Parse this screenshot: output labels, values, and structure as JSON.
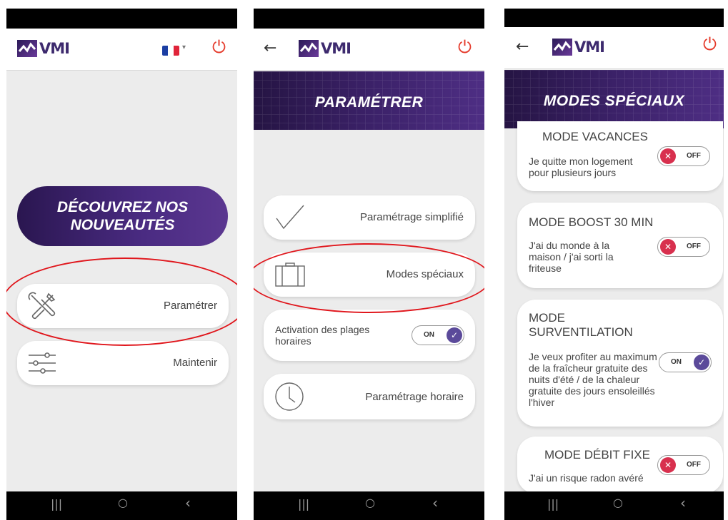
{
  "brand": {
    "logo_text": "VMI",
    "accent": "#4a2b82",
    "power_color": "#e53b2c"
  },
  "screen1": {
    "hero_line1": "DÉCOUVREZ NOS",
    "hero_line2": "NOUVEAUTÉS",
    "menu": [
      {
        "label": "Paramétrer",
        "icon": "tools-icon"
      },
      {
        "label": "Maintenir",
        "icon": "sliders-icon"
      }
    ]
  },
  "screen2": {
    "title": "PARAMÉTRER",
    "items": [
      {
        "label": "Paramétrage simplifié",
        "icon": "checkmark-icon"
      },
      {
        "label": "Modes spéciaux",
        "icon": "suitcase-icon"
      },
      {
        "label": "Activation des plages horaires",
        "toggle": "ON"
      },
      {
        "label": "Paramétrage horaire",
        "icon": "clock-icon"
      }
    ]
  },
  "screen3": {
    "title": "MODES SPÉCIAUX",
    "modes": [
      {
        "title": "MODE VACANCES",
        "desc": "Je quitte mon logement pour plusieurs jours",
        "state": "OFF"
      },
      {
        "title": "MODE BOOST 30 MIN",
        "desc": "J'ai du monde à la maison / j'ai sorti la friteuse",
        "state": "OFF"
      },
      {
        "title_line1": "MODE",
        "title_line2": "SURVENTILATION",
        "desc": "Je veux profiter au maximum de la fraîcheur gratuite des nuits d'été / de la chaleur gratuite des jours ensoleillés l'hiver",
        "state": "ON"
      },
      {
        "title": "MODE DÉBIT FIXE",
        "desc": "J'ai un risque radon avéré",
        "state": "OFF"
      }
    ]
  },
  "nav": {
    "recent": "|||",
    "home": "○",
    "back": "‹"
  }
}
